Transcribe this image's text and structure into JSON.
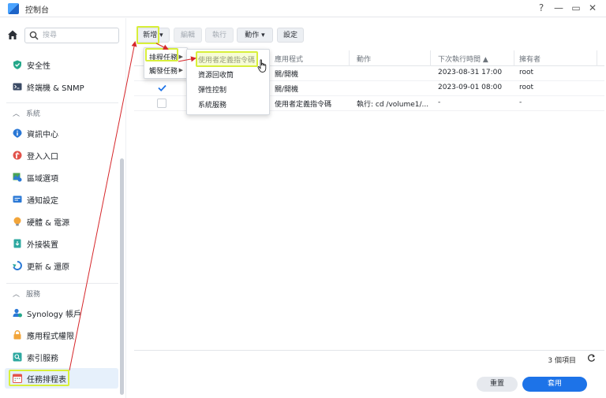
{
  "window": {
    "title": "控制台",
    "controls": [
      "?",
      "—",
      "▭",
      "✕"
    ]
  },
  "sidebar": {
    "search_placeholder": "搜尋",
    "items_top": [
      {
        "label": "安全性",
        "icon": "shield-icon",
        "color": "#25a78a"
      },
      {
        "label": "終端機 & SNMP",
        "icon": "terminal-icon",
        "color": "#3a4a64"
      }
    ],
    "section_system": "系統",
    "items_system": [
      {
        "label": "資訊中心",
        "icon": "info-icon",
        "color": "#2a78d6"
      },
      {
        "label": "登入入口",
        "icon": "login-portal-icon",
        "color": "#e2524a"
      },
      {
        "label": "區域選項",
        "icon": "region-icon",
        "color": "#4aa455"
      },
      {
        "label": "通知設定",
        "icon": "notification-icon",
        "color": "#2a78d6"
      },
      {
        "label": "硬體 & 電源",
        "icon": "bulb-icon",
        "color": "#f2a53a"
      },
      {
        "label": "外接裝置",
        "icon": "external-device-icon",
        "color": "#2da8a0"
      },
      {
        "label": "更新 & 還原",
        "icon": "update-icon",
        "color": "#2a78d6"
      }
    ],
    "section_services": "服務",
    "items_services": [
      {
        "label": "Synology 帳戶",
        "icon": "synology-account-icon",
        "color": "#2a78d6"
      },
      {
        "label": "應用程式權限",
        "icon": "lock-icon",
        "color": "#f2a53a"
      },
      {
        "label": "索引服務",
        "icon": "index-service-icon",
        "color": "#2da8a0"
      },
      {
        "label": "任務排程表",
        "icon": "calendar-icon",
        "color": "#e2524a",
        "active": true
      }
    ]
  },
  "toolbar": {
    "create": "新增",
    "edit": "編輯",
    "run": "執行",
    "action": "動作",
    "settings": "設定"
  },
  "table": {
    "columns": [
      "",
      "應用程式",
      "動作",
      "下次執行時間 ▲",
      "擁有者"
    ],
    "rows": [
      {
        "checked": false,
        "app": "關/開機",
        "action": "",
        "next_run": "2023-08-31 17:00",
        "owner": "root"
      },
      {
        "checked": true,
        "app": "關/開機",
        "action": "",
        "next_run": "2023-09-01 08:00",
        "owner": "root"
      },
      {
        "checked": false,
        "app": "使用者定義指令碼",
        "action": "執行: cd /volume1/...",
        "next_run": "-",
        "owner": "-"
      }
    ]
  },
  "create_menu": {
    "items": [
      {
        "label": "排程任務"
      },
      {
        "label": "觸發任務"
      }
    ]
  },
  "submenu": {
    "items": [
      {
        "label": "使用者定義指令碼"
      },
      {
        "label": "資源回收筒"
      },
      {
        "label": "彈性控制"
      },
      {
        "label": "系統服務"
      }
    ]
  },
  "footer": {
    "count": "3 個項目",
    "refresh": "C",
    "reset": "重置",
    "apply": "套用"
  },
  "colors": {
    "accent": "#1d73e8",
    "highlight_box": "#d8ef3a",
    "annotation_arrow": "#d6262a"
  }
}
